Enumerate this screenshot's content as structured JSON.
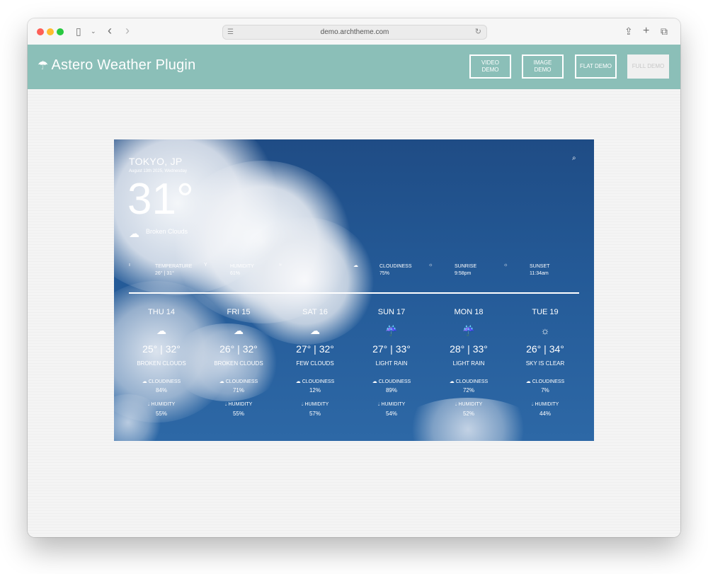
{
  "browser": {
    "address": "demo.archtheme.com"
  },
  "site": {
    "title": "Astero Weather Plugin",
    "buttons": [
      {
        "label": "VIDEO DEMO"
      },
      {
        "label": "IMAGE DEMO"
      },
      {
        "label": "FLAT DEMO"
      },
      {
        "label": "FULL DEMO"
      }
    ]
  },
  "weather": {
    "city": "TOKYO, JP",
    "date": "August 13th 2025, Wednesday",
    "temperature": "31°",
    "condition": "Broken Clouds",
    "stats": [
      {
        "icon": "thermometer-icon",
        "label": "TEMPERATURE",
        "value": "26° | 31°"
      },
      {
        "icon": "humidity-icon",
        "label": "HUMIDITY",
        "value": "61%"
      },
      {
        "icon": "wind-icon",
        "label": "",
        "value": ""
      },
      {
        "icon": "cloud-icon",
        "label": "CLOUDINESS",
        "value": "75%"
      },
      {
        "icon": "sunrise-icon",
        "label": "SUNRISE",
        "value": "9:58pm"
      },
      {
        "icon": "sunset-icon",
        "label": "SUNSET",
        "value": "11:34am"
      }
    ],
    "forecast": [
      {
        "day": "THU 14",
        "icon": "broken-clouds-icon",
        "range": "25° | 32°",
        "desc": "BROKEN CLOUDS",
        "cloud_label": "CLOUDINESS",
        "cloudiness": "84%",
        "hum_label": "HUMIDITY",
        "humidity": "55%"
      },
      {
        "day": "FRI 15",
        "icon": "broken-clouds-icon",
        "range": "26° | 32°",
        "desc": "BROKEN CLOUDS",
        "cloud_label": "CLOUDINESS",
        "cloudiness": "71%",
        "hum_label": "HUMIDITY",
        "humidity": "55%"
      },
      {
        "day": "SAT 16",
        "icon": "few-clouds-icon",
        "range": "27° | 32°",
        "desc": "FEW CLOUDS",
        "cloud_label": "CLOUDINESS",
        "cloudiness": "12%",
        "hum_label": "HUMIDITY",
        "humidity": "57%"
      },
      {
        "day": "SUN 17",
        "icon": "light-rain-icon",
        "range": "27° | 33°",
        "desc": "LIGHT RAIN",
        "cloud_label": "CLOUDINESS",
        "cloudiness": "89%",
        "hum_label": "HUMIDITY",
        "humidity": "54%"
      },
      {
        "day": "MON 18",
        "icon": "light-rain-icon",
        "range": "28° | 33°",
        "desc": "LIGHT RAIN",
        "cloud_label": "CLOUDINESS",
        "cloudiness": "72%",
        "hum_label": "HUMIDITY",
        "humidity": "52%"
      },
      {
        "day": "TUE 19",
        "icon": "sun-icon",
        "range": "26° | 34°",
        "desc": "SKY IS CLEAR",
        "cloud_label": "CLOUDINESS",
        "cloudiness": "7%",
        "hum_label": "HUMIDITY",
        "humidity": "44%"
      }
    ]
  }
}
